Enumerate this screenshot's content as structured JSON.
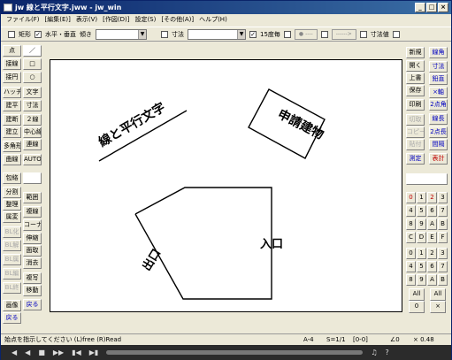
{
  "window": {
    "title": "jw 線と平行文字.jww - jw_win",
    "min": "_",
    "max": "□",
    "close": "×"
  },
  "menu": [
    "ファイル(F)",
    "[編集(E)]",
    "表示(V)",
    "[作図(D)]",
    "設定(S)",
    "[その他(A)]",
    "ヘルプ(H)"
  ],
  "toolbar": {
    "rect_label": "矩形",
    "hv_label": "水平・垂直",
    "tilt_label": "傾き",
    "size_label": "寸法",
    "deg_label": "15度毎",
    "dim_value_label": "寸法値",
    "ghost1": "● ----",
    "ghost2": "------>",
    "check_hv": "✓",
    "check_deg": "✓",
    "arrow": "▼"
  },
  "left_tools": [
    "点",
    "／",
    "接線",
    "□",
    "接円",
    "○",
    "ハッチ",
    "文字",
    "建平",
    "寸法",
    "建断",
    "２線",
    "建立",
    "中心線",
    "多角形",
    "連線",
    "曲線",
    "AUTO",
    "包絡",
    "",
    "分割",
    "範囲",
    "整理",
    "複線",
    "属変",
    "コーナー",
    "BL化",
    "伸縮",
    "BL解",
    "面取",
    "BL属",
    "消去",
    "BL編",
    "複写",
    "BL終",
    "移動",
    "画像",
    "戻る",
    "戻る",
    ""
  ],
  "right_tools": [
    "新規",
    "開く",
    "上書",
    "保存",
    "印刷",
    "切取",
    "コピー",
    "貼付",
    "線角",
    "寸法",
    "鉛直",
    "×軸",
    "2点角",
    "線長",
    "2点長",
    "間隔",
    "測定",
    "表計",
    "日影",
    "天空",
    "",
    "",
    "",
    "",
    "",
    "",
    "",
    "",
    "All",
    "All",
    "0",
    "×",
    "0",
    "1",
    "2",
    "3",
    "4",
    "5",
    "6",
    "7",
    "8",
    "9",
    "A",
    "B",
    "C",
    "D",
    "E",
    "F"
  ],
  "drawing": {
    "diag_text": "線と平行文字",
    "box_text": "申請建物",
    "entrance": "入口",
    "exit": "出口"
  },
  "status": {
    "prompt": "始点を指示してください (L)free (R)Read",
    "paper": "A-4",
    "scale": "S=1/1",
    "layer": "[0-0]",
    "angle": "∠0",
    "zoom": "× 0.48"
  },
  "player": {
    "buttons": [
      "◀",
      "◀",
      "■",
      "▶▶",
      "▮◀",
      "▶▮",
      "♫",
      "?"
    ]
  }
}
